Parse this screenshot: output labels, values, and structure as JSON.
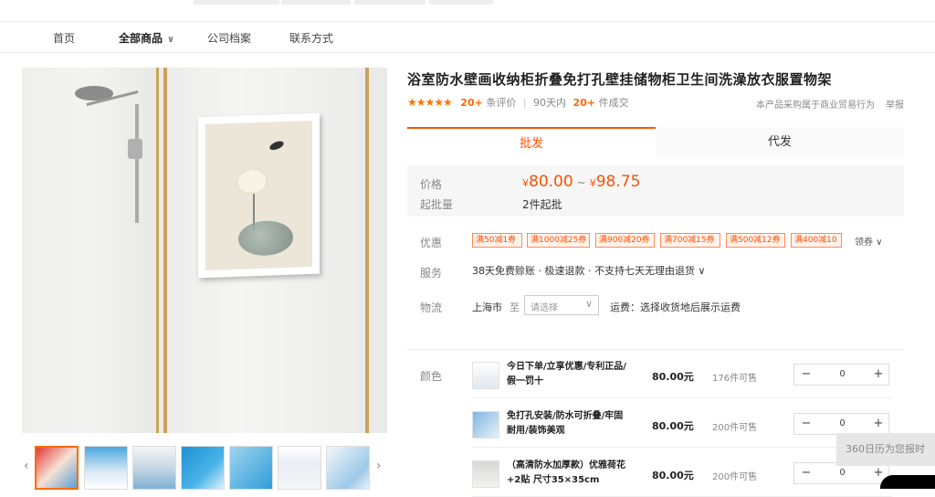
{
  "nav": {
    "items": [
      {
        "label": "首页"
      },
      {
        "label": "全部商品"
      },
      {
        "label": "公司档案"
      },
      {
        "label": "联系方式"
      }
    ],
    "active_index": 1
  },
  "product": {
    "title": "浴室防水壁画收纳柜折叠免打孔壁挂储物柜卫生间洗澡放衣服置物架",
    "rating_stars": "★★★★★",
    "review_count": "20+",
    "review_label": "条评价",
    "sales_period": "90天内",
    "sales_count": "20+",
    "sales_label": "件成交",
    "notice": "本产品采购属于商业贸易行为",
    "report": "举报"
  },
  "tabs": {
    "wholesale": "批发",
    "dropship": "代发"
  },
  "price": {
    "label": "价格",
    "currency": "¥",
    "min": "80.00",
    "tilde": "~",
    "max": "98.75",
    "moq_label": "起批量",
    "moq_value": "2件起批"
  },
  "promo": {
    "label": "优惠",
    "coupons": [
      "满50减1券",
      "满1000减25券",
      "满900减20券",
      "满700减15券",
      "满500减12券",
      "满400减10"
    ],
    "get_coupon": "领券 ∨"
  },
  "service": {
    "label": "服务",
    "text": "38天免费赊账 · 极速退款 · 不支持七天无理由退货 ∨"
  },
  "logistics": {
    "label": "物流",
    "from": "上海市",
    "to": "至",
    "select_placeholder": "请选择",
    "freight": "运费：选择收货地后展示运费"
  },
  "sku": {
    "label": "颜色",
    "items": [
      {
        "name": "今日下单/立享优惠/专利正品/假一罚十",
        "price": "80.00元",
        "stock": "176件可售",
        "qty": "0"
      },
      {
        "name": "免打孔安装/防水可折叠/牢固耐用/装饰美观",
        "price": "80.00元",
        "stock": "200件可售",
        "qty": "0"
      },
      {
        "name": "（高清防水加厚款）优雅荷花+2贴 尺寸35×35cm",
        "price": "80.00元",
        "stock": "200件可售",
        "qty": "0"
      }
    ]
  },
  "stepper": {
    "minus": "−",
    "plus": "+"
  },
  "history_bar": "360日历为您报时",
  "colors": {
    "accent": "#ff5000",
    "star": "#ff7300"
  }
}
